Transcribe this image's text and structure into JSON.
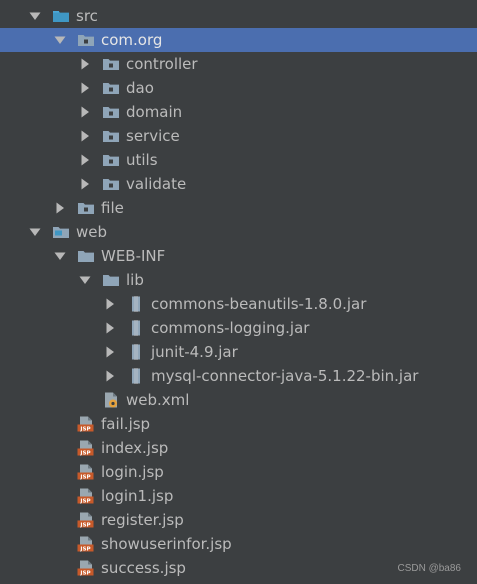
{
  "tree": [
    {
      "label": "src",
      "icon": "folder-source-icon",
      "arrow": "expanded",
      "level": 0,
      "selected": false
    },
    {
      "label": "com.org",
      "icon": "package-icon",
      "arrow": "expanded",
      "level": 1,
      "selected": true
    },
    {
      "label": "controller",
      "icon": "package-icon",
      "arrow": "collapsed",
      "level": 2,
      "selected": false
    },
    {
      "label": "dao",
      "icon": "package-icon",
      "arrow": "collapsed",
      "level": 2,
      "selected": false
    },
    {
      "label": "domain",
      "icon": "package-icon",
      "arrow": "collapsed",
      "level": 2,
      "selected": false
    },
    {
      "label": "service",
      "icon": "package-icon",
      "arrow": "collapsed",
      "level": 2,
      "selected": false
    },
    {
      "label": "utils",
      "icon": "package-icon",
      "arrow": "collapsed",
      "level": 2,
      "selected": false
    },
    {
      "label": "validate",
      "icon": "package-icon",
      "arrow": "collapsed",
      "level": 2,
      "selected": false
    },
    {
      "label": "file",
      "icon": "package-icon",
      "arrow": "collapsed",
      "level": 1,
      "selected": false
    },
    {
      "label": "web",
      "icon": "folder-web-icon",
      "arrow": "expanded",
      "level": 0,
      "selected": false
    },
    {
      "label": "WEB-INF",
      "icon": "folder-icon",
      "arrow": "expanded",
      "level": 1,
      "selected": false
    },
    {
      "label": "lib",
      "icon": "folder-icon",
      "arrow": "expanded",
      "level": 2,
      "selected": false
    },
    {
      "label": "commons-beanutils-1.8.0.jar",
      "icon": "jar-icon",
      "arrow": "collapsed",
      "level": 3,
      "selected": false
    },
    {
      "label": "commons-logging.jar",
      "icon": "jar-icon",
      "arrow": "collapsed",
      "level": 3,
      "selected": false
    },
    {
      "label": "junit-4.9.jar",
      "icon": "jar-icon",
      "arrow": "collapsed",
      "level": 3,
      "selected": false
    },
    {
      "label": "mysql-connector-java-5.1.22-bin.jar",
      "icon": "jar-icon",
      "arrow": "collapsed",
      "level": 3,
      "selected": false
    },
    {
      "label": "web.xml",
      "icon": "xml-file-icon",
      "arrow": "none",
      "level": 2,
      "selected": false
    },
    {
      "label": "fail.jsp",
      "icon": "jsp-file-icon",
      "arrow": "none",
      "level": 1,
      "selected": false
    },
    {
      "label": "index.jsp",
      "icon": "jsp-file-icon",
      "arrow": "none",
      "level": 1,
      "selected": false
    },
    {
      "label": "login.jsp",
      "icon": "jsp-file-icon",
      "arrow": "none",
      "level": 1,
      "selected": false
    },
    {
      "label": "login1.jsp",
      "icon": "jsp-file-icon",
      "arrow": "none",
      "level": 1,
      "selected": false
    },
    {
      "label": "register.jsp",
      "icon": "jsp-file-icon",
      "arrow": "none",
      "level": 1,
      "selected": false
    },
    {
      "label": "showuserinfor.jsp",
      "icon": "jsp-file-icon",
      "arrow": "none",
      "level": 1,
      "selected": false
    },
    {
      "label": "success.jsp",
      "icon": "jsp-file-icon",
      "arrow": "none",
      "level": 1,
      "selected": false
    }
  ],
  "watermark": "CSDN @ba86",
  "colors": {
    "background": "#3c3f41",
    "selection": "#4b6eaf",
    "text": "#bbbbbb",
    "folder": "#8fa5b8",
    "source_folder": "#3f97c4",
    "jsp_badge": "#c75a2a"
  }
}
